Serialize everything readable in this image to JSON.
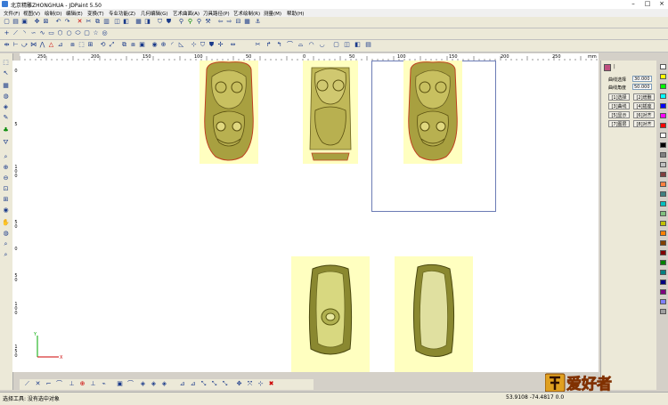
{
  "window": {
    "title": "北京精雕ZHONGHUA - JDPaint 5.50"
  },
  "menu": [
    "文件(F)",
    "视图(V)",
    "绘制(D)",
    "编辑(E)",
    "变换(T)",
    "专业功能(Z)",
    "几何编辑(G)",
    "艺术曲面(A)",
    "刀具路径(P)",
    "艺术绘制(R)",
    "测量(M)",
    "帮助(H)"
  ],
  "ruler": {
    "h_ticks": [
      "250",
      "200",
      "150",
      "100",
      "50",
      "0",
      "50",
      "100",
      "150",
      "200",
      "250"
    ],
    "unit": "mm",
    "v_ticks": [
      "0",
      "5",
      "1 0 0",
      "5 0",
      "0",
      "5 0",
      "1 0 0",
      "1 5 0"
    ]
  },
  "panel": {
    "lock_label": "|",
    "fields": [
      {
        "label": "曲线选择",
        "value": "30.000"
      },
      {
        "label": "曲线角度",
        "value": "50.000"
      }
    ],
    "buttons": [
      "[1]选择",
      "[2]增删",
      "[3]曲线",
      "[4]插座",
      "[5]显示",
      "[6]对齐",
      "[7]图层",
      "[8]对齐"
    ]
  },
  "palette": [
    "#ffffff",
    "#ffff00",
    "#00ff00",
    "#00ffff",
    "#0000ff",
    "#ff00ff",
    "#ff0000",
    "#ffffff",
    "#000000",
    "#808080",
    "#c0c0c0",
    "#804040",
    "#ff8040",
    "#408080",
    "#00c0c0",
    "#80c080",
    "#c0c000",
    "#ff8000",
    "#804000",
    "#800000",
    "#008000",
    "#008080",
    "#000080",
    "#800080",
    "#8080ff",
    "#a0a0a0"
  ],
  "status": {
    "left": "选择工具: 没有选中对象",
    "right": "53.9108  -74.4817  0.0"
  },
  "axis": {
    "x": "X",
    "y": "Y"
  },
  "logo": {
    "text": "爱好者"
  }
}
